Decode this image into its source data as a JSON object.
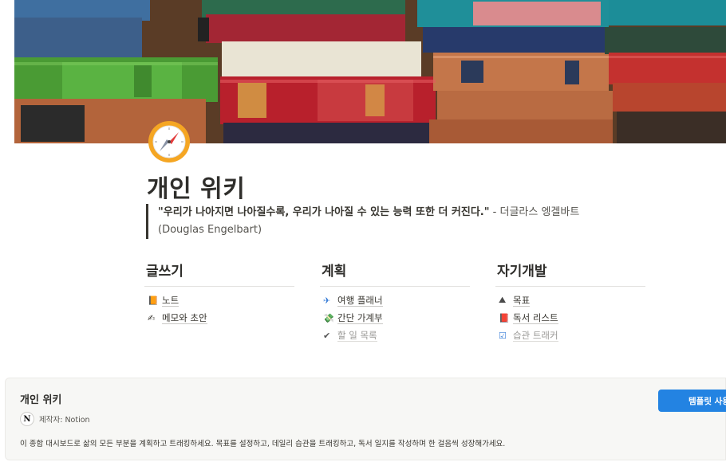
{
  "page": {
    "title": "개인 위키",
    "icon": "compass-icon"
  },
  "quote": {
    "main": "\"우리가 나아지면 나아질수록, 우리가 나아질 수 있는 능력 또한 더 커진다.\"",
    "author_line1": " - 더글라스 엥겔바트",
    "author_line2": "(Douglas Engelbart)"
  },
  "columns": [
    {
      "heading": "글쓰기",
      "items": [
        {
          "icon": "📙",
          "label": "노트",
          "faded": false
        },
        {
          "icon": "✍",
          "label": "메모와 초안",
          "faded": false
        }
      ]
    },
    {
      "heading": "계획",
      "items": [
        {
          "icon": "✈",
          "label": "여행 플래너",
          "faded": false
        },
        {
          "icon": "💸",
          "label": "간단 가계부",
          "faded": false
        },
        {
          "icon": "✔",
          "label": "할 일 목록",
          "faded": true
        }
      ]
    },
    {
      "heading": "자기개발",
      "items": [
        {
          "icon": "⛰",
          "label": "목표",
          "faded": false
        },
        {
          "icon": "📕",
          "label": "독서 리스트",
          "faded": false
        },
        {
          "icon": "☑",
          "label": "습관 트래커",
          "faded": true
        }
      ]
    }
  ],
  "footer": {
    "title": "개인 위키",
    "creator_avatar": "N",
    "creator": "제작자: Notion",
    "description": "이 종합 대시보드로 삶의 모든 부분을 계획하고 트래킹하세요. 목표를 설정하고, 데일리 습관을 트래킹하고, 독서 일지를 작성하며 한 걸음씩 성장해가세요.",
    "button_label": "템플릿 사용"
  },
  "colors": {
    "accent": "#2383e2",
    "compass_ring": "#f5a623"
  }
}
